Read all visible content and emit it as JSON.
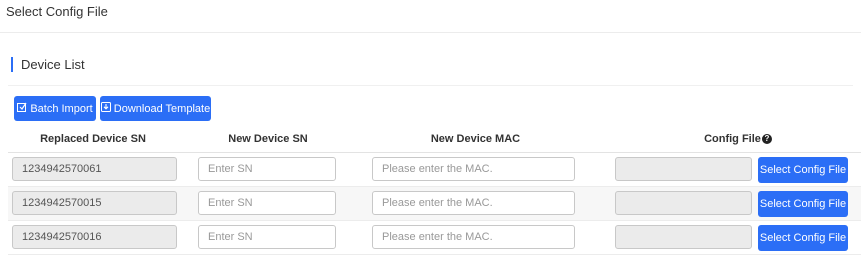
{
  "page": {
    "title": "Select Config File"
  },
  "section": {
    "title": "Device List"
  },
  "toolbar": {
    "batch_import_label": "Batch Import",
    "download_template_label": "Download Template"
  },
  "table": {
    "headers": {
      "replaced_sn": "Replaced Device SN",
      "new_sn": "New Device SN",
      "new_mac": "New Device MAC",
      "config_file": "Config File",
      "help_glyph": "?"
    },
    "rows": [
      {
        "replaced_sn": "1234942570061",
        "new_sn_placeholder": "Enter SN",
        "mac_placeholder": "Please enter the MAC.",
        "config_value": "",
        "select_label": "Select Config File"
      },
      {
        "replaced_sn": "1234942570015",
        "new_sn_placeholder": "Enter SN",
        "mac_placeholder": "Please enter the MAC.",
        "config_value": "",
        "select_label": "Select Config File"
      },
      {
        "replaced_sn": "1234942570016",
        "new_sn_placeholder": "Enter SN",
        "mac_placeholder": "Please enter the MAC.",
        "config_value": "",
        "select_label": "Select Config File"
      }
    ]
  },
  "colors": {
    "accent": "#2b6ef6",
    "readonly_bg": "#ebebeb"
  },
  "icons": {
    "batch_import": "import-icon",
    "download_template": "download-icon",
    "config_help": "help-icon"
  }
}
